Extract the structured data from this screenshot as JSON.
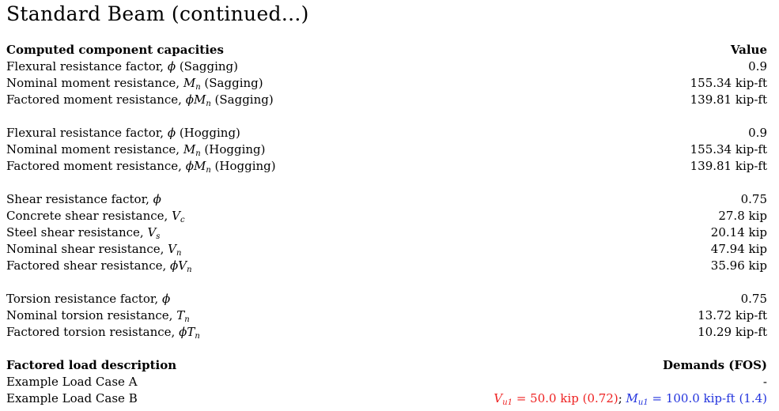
{
  "title": "Standard Beam (continued...)",
  "capacities": {
    "header_label": "Computed component capacities",
    "header_value": "Value",
    "groups": [
      [
        {
          "pre": "Flexural resistance factor, ",
          "sym": "ϕ",
          "sub": "",
          "post": " (Sagging)",
          "value": "0.9"
        },
        {
          "pre": "Nominal moment resistance, ",
          "sym": "M",
          "sub": "n",
          "post": " (Sagging)",
          "value": "155.34 kip-ft"
        },
        {
          "pre": "Factored moment resistance, ",
          "sym": "ϕM",
          "sub": "n",
          "post": " (Sagging)",
          "value": "139.81 kip-ft"
        }
      ],
      [
        {
          "pre": "Flexural resistance factor, ",
          "sym": "ϕ",
          "sub": "",
          "post": " (Hogging)",
          "value": "0.9"
        },
        {
          "pre": "Nominal moment resistance, ",
          "sym": "M",
          "sub": "n",
          "post": " (Hogging)",
          "value": "155.34 kip-ft"
        },
        {
          "pre": "Factored moment resistance, ",
          "sym": "ϕM",
          "sub": "n",
          "post": " (Hogging)",
          "value": "139.81 kip-ft"
        }
      ],
      [
        {
          "pre": "Shear resistance factor, ",
          "sym": "ϕ",
          "sub": "",
          "post": "",
          "value": "0.75"
        },
        {
          "pre": "Concrete shear resistance, ",
          "sym": "V",
          "sub": "c",
          "post": "",
          "value": "27.8 kip"
        },
        {
          "pre": "Steel shear resistance, ",
          "sym": "V",
          "sub": "s",
          "post": "",
          "value": "20.14 kip"
        },
        {
          "pre": "Nominal shear resistance, ",
          "sym": "V",
          "sub": "n",
          "post": "",
          "value": "47.94 kip"
        },
        {
          "pre": "Factored shear resistance, ",
          "sym": "ϕV",
          "sub": "n",
          "post": "",
          "value": "35.96 kip"
        }
      ],
      [
        {
          "pre": "Torsion resistance factor, ",
          "sym": "ϕ",
          "sub": "",
          "post": "",
          "value": "0.75"
        },
        {
          "pre": "Nominal torsion resistance, ",
          "sym": "T",
          "sub": "n",
          "post": "",
          "value": "13.72 kip-ft"
        },
        {
          "pre": "Factored torsion resistance, ",
          "sym": "ϕT",
          "sub": "n",
          "post": "",
          "value": "10.29 kip-ft"
        }
      ]
    ]
  },
  "loads": {
    "header_label": "Factored load description",
    "header_value": "Demands (FOS)",
    "case_a": {
      "label": "Example Load Case A",
      "value": "-"
    },
    "case_b": {
      "label": "Example Load Case B",
      "shear_sym": "V",
      "shear_sub": "u1",
      "shear_text": " = 50.0 kip (0.72)",
      "separator": "; ",
      "moment_sym": "M",
      "moment_sub": "u1",
      "moment_text": " = 100.0 kip-ft (1.4)"
    }
  },
  "colors": {
    "text": "#000000",
    "shear_demand": "#ee2222",
    "moment_demand": "#2233dd"
  }
}
